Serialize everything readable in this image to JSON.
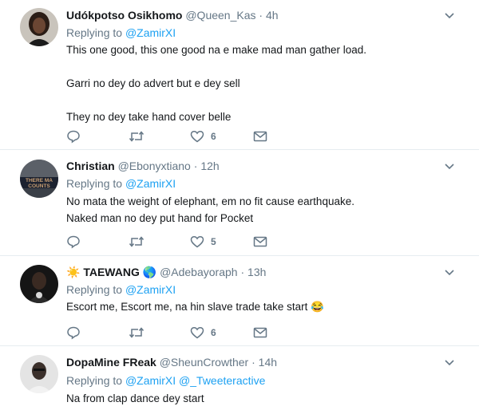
{
  "tweets": [
    {
      "name": "Udókpotso Osikhomo",
      "handle": "@Queen_Kas",
      "time": "4h",
      "replying_prefix": "Replying to",
      "mentions": [
        "@ZamirXI"
      ],
      "lines": [
        "This one good, this one good na e make mad man gather load.",
        "",
        "Garri no dey do advert but e dey  sell",
        "",
        "They no dey take hand cover belle"
      ],
      "likes": "6"
    },
    {
      "name": "Christian",
      "handle": "@Ebonyxtiano",
      "time": "12h",
      "replying_prefix": "Replying to",
      "mentions": [
        "@ZamirXI"
      ],
      "lines": [
        "No mata the weight of elephant, em no fit cause earthquake.",
        "Naked man no dey put hand for Pocket"
      ],
      "likes": "5",
      "avatar_text": "THERE MA COUNTS"
    },
    {
      "name_prefix_emoji": "☀️",
      "name": "TAEWANG",
      "name_suffix_emoji": "🌎",
      "handle": "@Adebayoraph",
      "time": "13h",
      "replying_prefix": "Replying to",
      "mentions": [
        "@ZamirXI"
      ],
      "lines": [
        "Escort me, Escort me, na hin slave trade take start 😂"
      ],
      "likes": "6"
    },
    {
      "name": "DopaMine FReak",
      "handle": "@SheunCrowther",
      "time": "14h",
      "replying_prefix": "Replying to",
      "mentions": [
        "@ZamirXI",
        "@_Tweeteractive"
      ],
      "lines": [
        "Na from clap dance dey start"
      ]
    }
  ],
  "separator": "·",
  "colors": {
    "accent": "#1da1f2",
    "secondary": "#657786",
    "border": "#e6ecf0",
    "text": "#14171a"
  }
}
